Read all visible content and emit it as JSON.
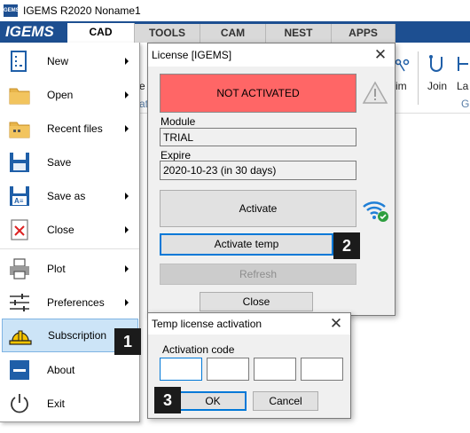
{
  "window": {
    "title": "IGEMS R2020  Noname1",
    "logo_small": "IGEMS",
    "brand": "IGEMS"
  },
  "ribbon": {
    "tabs": [
      {
        "label": "CAD",
        "active": true
      },
      {
        "label": "TOOLS",
        "active": false
      },
      {
        "label": "CAM",
        "active": false
      },
      {
        "label": "NEST",
        "active": false
      },
      {
        "label": "APPS",
        "active": false
      }
    ],
    "visible_items": {
      "e_label": "e",
      "at_label": "at",
      "im_label": "im",
      "join_label": "Join",
      "la_label": "La",
      "g_label": "G"
    }
  },
  "file_menu": {
    "items": [
      {
        "label": "New",
        "icon": "new-file-icon",
        "submenu": true
      },
      {
        "label": "Open",
        "icon": "folder-icon",
        "submenu": true
      },
      {
        "label": "Recent files",
        "icon": "recent-folder-icon",
        "submenu": true
      },
      {
        "label": "Save",
        "icon": "save-icon",
        "submenu": false
      },
      {
        "label": "Save as",
        "icon": "save-as-icon",
        "submenu": true
      },
      {
        "label": "Close",
        "icon": "close-file-icon",
        "submenu": true
      },
      {
        "label": "Plot",
        "icon": "printer-icon",
        "submenu": true
      },
      {
        "label": "Preferences",
        "icon": "sliders-icon",
        "submenu": true
      },
      {
        "label": "Subscription",
        "icon": "hardhat-icon",
        "submenu": false,
        "selected": true
      },
      {
        "label": "About",
        "icon": "about-icon",
        "submenu": false
      },
      {
        "label": "Exit",
        "icon": "power-icon",
        "submenu": false
      }
    ]
  },
  "license_dialog": {
    "title": "License [IGEMS]",
    "status": "NOT ACTIVATED",
    "status_color": "#ff6666",
    "module_label": "Module",
    "module_value": "TRIAL",
    "expire_label": "Expire",
    "expire_value": "2020-10-23 (in 30 days)",
    "activate_button": "Activate",
    "activate_temp_button": "Activate temp",
    "refresh_button": "Refresh",
    "close_button": "Close"
  },
  "temp_dialog": {
    "title": "Temp license activation",
    "code_label": "Activation code",
    "code_values": [
      "",
      "",
      "",
      ""
    ],
    "ok_button": "OK",
    "cancel_button": "Cancel"
  },
  "callouts": [
    "1",
    "2",
    "3"
  ],
  "colors": {
    "ribbon_blue": "#1d4f91",
    "selection": "#cce4f7",
    "focus": "#0078d7",
    "wifi_blue": "#1f7fd6",
    "check_green": "#2e9e3f",
    "hardhat_yellow": "#f6c400"
  }
}
